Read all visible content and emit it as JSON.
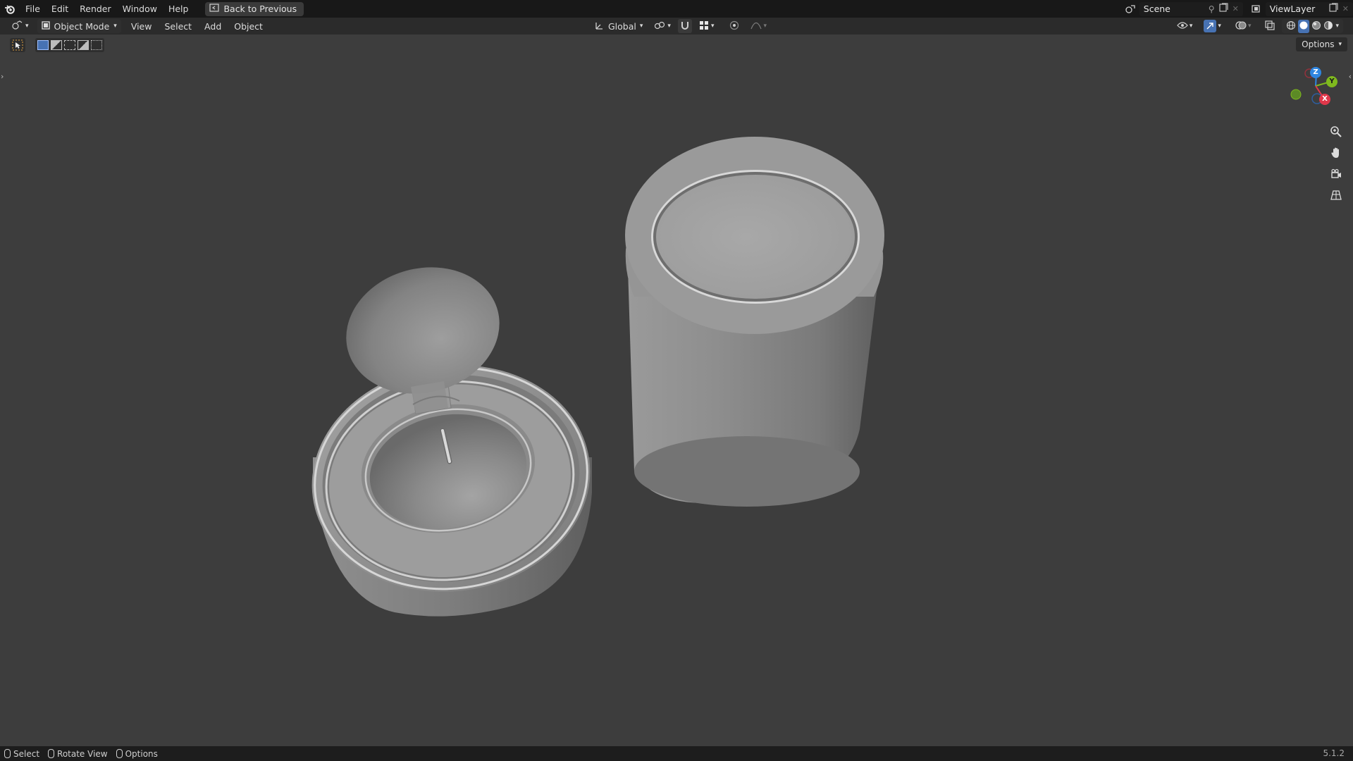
{
  "topbar": {
    "menus": [
      "File",
      "Edit",
      "Render",
      "Window",
      "Help"
    ],
    "back_label": "Back to Previous",
    "scene_name": "Scene",
    "viewlayer_name": "ViewLayer"
  },
  "header": {
    "mode_label": "Object Mode",
    "menus": [
      "View",
      "Select",
      "Add",
      "Object"
    ],
    "transform_orientation": "Global"
  },
  "options_label": "Options",
  "gizmo": {
    "x": "X",
    "y": "Y",
    "z": "Z"
  },
  "status": {
    "select": "Select",
    "rotate": "Rotate View",
    "options": "Options",
    "version": "5.1.2"
  },
  "colors": {
    "axis_x": "#e0374a",
    "axis_y": "#7fb91e",
    "axis_z": "#2f86e0",
    "viewport_bg": "#3d3d3d",
    "active_blue": "#4772b3"
  }
}
